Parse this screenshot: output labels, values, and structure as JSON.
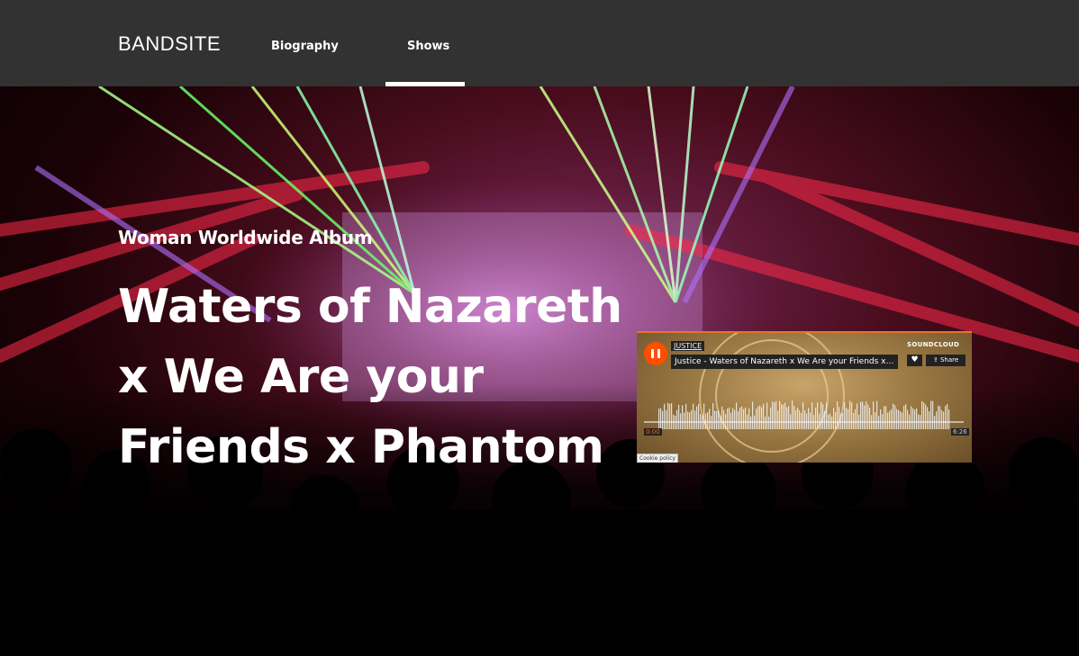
{
  "nav": {
    "logo": "BANDSITE",
    "links": [
      {
        "label": "Biography"
      },
      {
        "label": "Shows",
        "active": true
      }
    ]
  },
  "hero": {
    "subtitle": "Woman Worldwide Album",
    "title": "Waters of Nazareth x We Are your Friends x Phantom"
  },
  "player": {
    "artist": "JUSTICE",
    "track": "Justice - Waters of Nazareth x We Are your Friends x…",
    "brand": "SOUNDCLOUD",
    "like_icon": "heart-icon",
    "share_label": "Share",
    "current_time": "0:00",
    "duration": "6:26",
    "cookie_label": "Cookie policy",
    "accent": "#ff4e00"
  },
  "colors": {
    "nav_bg": "#323232",
    "text": "#ffffff"
  }
}
